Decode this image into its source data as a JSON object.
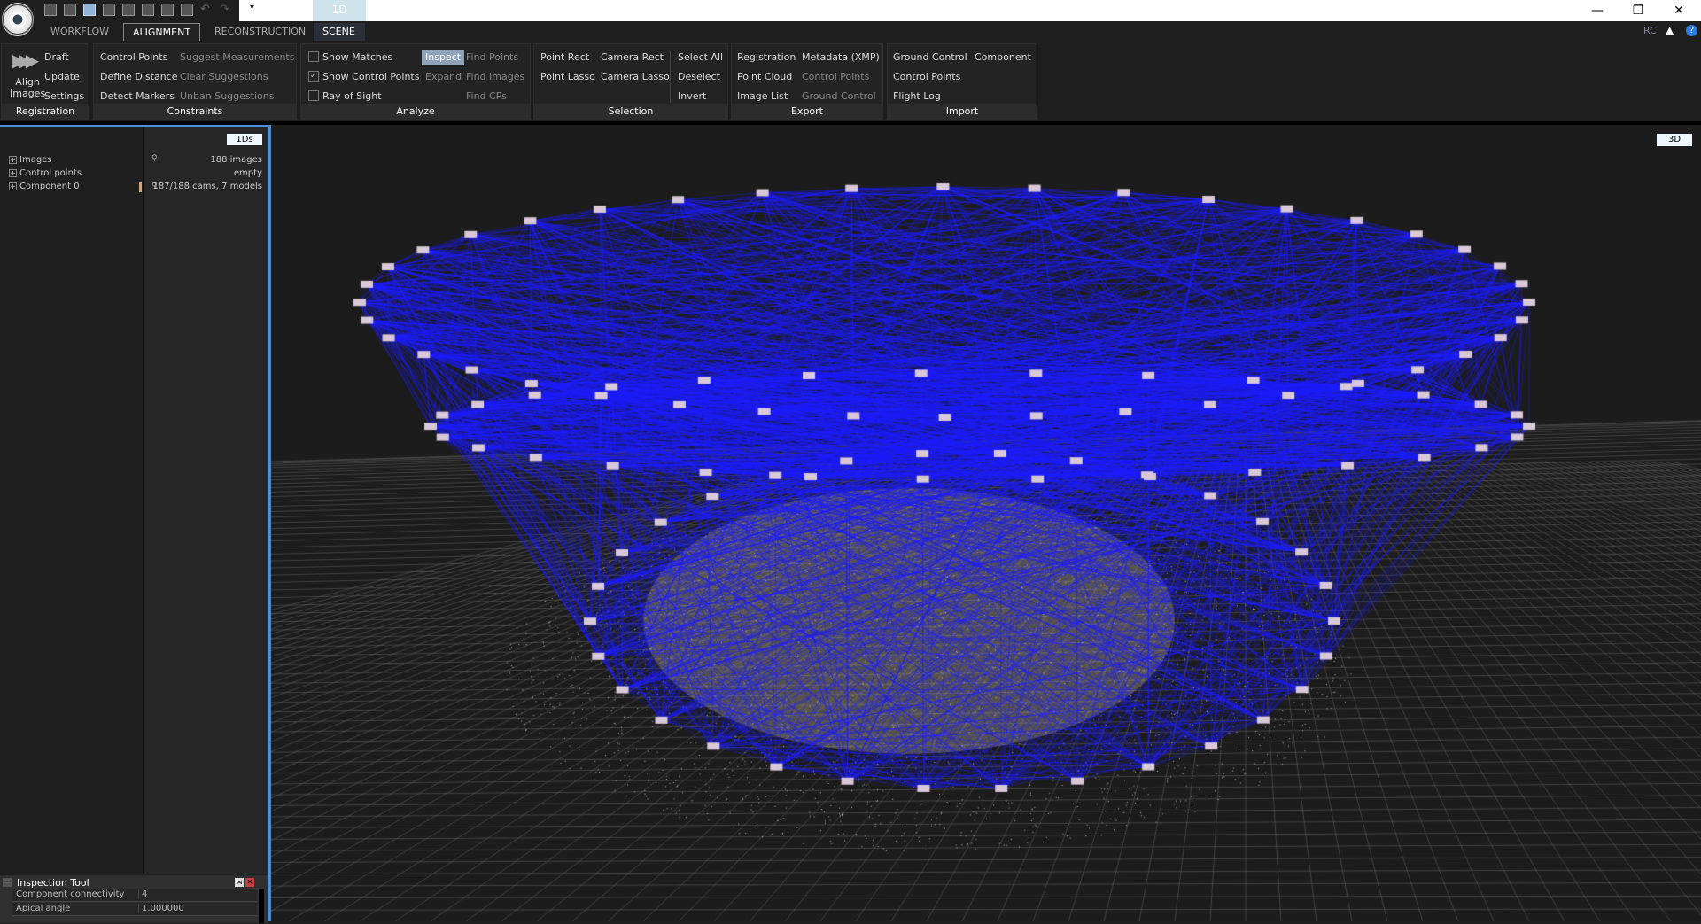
{
  "titlebar": {
    "tab_1d": "1D",
    "controls": [
      "minimize-icon",
      "restore-icon",
      "close-icon"
    ]
  },
  "tabs": [
    "WORKFLOW",
    "ALIGNMENT",
    "RECONSTRUCTION",
    "SCENE"
  ],
  "header_right": {
    "rc": "RC",
    "icons": [
      "warning-icon",
      "help-icon"
    ]
  },
  "ribbon": {
    "registration": {
      "label": "Registration",
      "align": "Align",
      "align2": "Images",
      "draft": "Draft",
      "update": "Update",
      "settings": "Settings"
    },
    "constraints": {
      "label": "Constraints",
      "control_points": "Control Points",
      "define_distance": "Define Distance",
      "detect_markers": "Detect Markers",
      "suggest": "Suggest Measurements",
      "clear": "Clear Suggestions",
      "unban": "Unban Suggestions"
    },
    "analyze": {
      "label": "Analyze",
      "show_matches": "Show Matches",
      "show_matches_checked": false,
      "show_cps": "Show Control Points",
      "show_cps_checked": true,
      "ray": "Ray of Sight",
      "ray_checked": false,
      "inspect": "Inspect",
      "expand": "Expand",
      "find_points": "Find Points",
      "find_images": "Find Images",
      "find_cps": "Find CPs"
    },
    "selection": {
      "label": "Selection",
      "point_rect": "Point Rect",
      "point_lasso": "Point Lasso",
      "camera_rect": "Camera Rect",
      "camera_lasso": "Camera Lasso",
      "select_all": "Select All",
      "deselect": "Deselect",
      "invert": "Invert"
    },
    "export": {
      "label": "Export",
      "registration": "Registration",
      "point_cloud": "Point Cloud",
      "image_list": "Image List",
      "metadata": "Metadata (XMP)",
      "control_points": "Control Points",
      "ground_control": "Ground Control"
    },
    "import": {
      "label": "Import",
      "ground_control": "Ground Control",
      "component": "Component",
      "control_points": "Control Points",
      "flight_log": "Flight Log"
    }
  },
  "left_panel": {
    "view_button": "1Ds",
    "tree": [
      {
        "label": "Images",
        "value": "188 images"
      },
      {
        "label": "Control points",
        "value": "empty"
      },
      {
        "label": "Component 0",
        "value": "187/188 cams, 7 models"
      }
    ],
    "inspection": {
      "title": "Inspection Tool",
      "rows": [
        {
          "key": "Component connectivity",
          "value": "4"
        },
        {
          "key": "Apical angle",
          "value": "1.000000"
        }
      ]
    }
  },
  "viewport": {
    "view_button": "3D",
    "colors": {
      "lines": "#1a1aff",
      "grid": "#6a6a6a"
    }
  }
}
